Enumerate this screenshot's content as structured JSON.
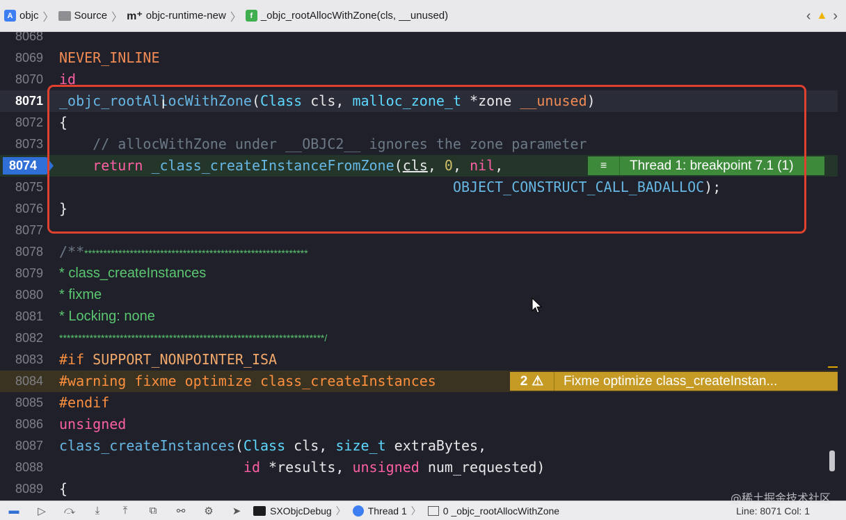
{
  "jumpbar": {
    "crumbs": [
      "objc",
      "Source",
      "objc-runtime-new",
      "_objc_rootAllocWithZone(cls, __unused)"
    ],
    "nav_back": "‹",
    "nav_forward": "›",
    "warn_icon": "warning-icon"
  },
  "editor": {
    "lines": [
      {
        "n": "8068"
      },
      {
        "n": "8069"
      },
      {
        "n": "8070"
      },
      {
        "n": "8071"
      },
      {
        "n": "8072"
      },
      {
        "n": "8073"
      },
      {
        "n": "8074"
      },
      {
        "n": "8075"
      },
      {
        "n": "8076"
      },
      {
        "n": "8077"
      },
      {
        "n": "8078"
      },
      {
        "n": "8079"
      },
      {
        "n": "8080"
      },
      {
        "n": "8081"
      },
      {
        "n": "8082"
      },
      {
        "n": "8083"
      },
      {
        "n": "8084"
      },
      {
        "n": "8085"
      },
      {
        "n": "8086"
      },
      {
        "n": "8087"
      },
      {
        "n": "8088"
      },
      {
        "n": "8089"
      }
    ],
    "code": {
      "l8069": "NEVER_INLINE",
      "l8070": "id",
      "l8071_func": "_objc_rootAllocWithZone",
      "l8071_open": "(",
      "l8071_type1": "Class",
      "l8071_arg1": " cls, ",
      "l8071_type2": "malloc_zone_t",
      "l8071_arg2": " *zone ",
      "l8071_unused": "__unused",
      "l8071_close": ")",
      "l8072": "{",
      "l8073": "    // allocWithZone under __OBJC2__ ignores the zone parameter",
      "l8074_ret": "    return ",
      "l8074_func": "_class_createInstanceFromZone",
      "l8074_open": "(",
      "l8074_cls": "cls",
      "l8074_comma1": ", ",
      "l8074_zero": "0",
      "l8074_comma2": ", ",
      "l8074_nil": "nil",
      "l8074_comma3": ",",
      "l8075_indent": "                                               ",
      "l8075_const": "OBJECT_CONSTRUCT_CALL_BADALLOC",
      "l8075_end": ");",
      "l8076": "}",
      "l8078_a": "/**",
      "l8078_b": "***********************************************************",
      "l8079": "* class_createInstances",
      "l8080": "* fixme",
      "l8081": "* Locking: none",
      "l8082": "**********************************************************************/",
      "l8083_a": "#if ",
      "l8083_b": "SUPPORT_NONPOINTER_ISA",
      "l8084": "#warning fixme optimize class_createInstances",
      "l8085": "#endif",
      "l8086": "unsigned",
      "l8087_func": "class_createInstances",
      "l8087_open": "(",
      "l8087_type1": "Class",
      "l8087_arg1": " cls, ",
      "l8087_type2": "size_t",
      "l8087_arg2": " extraBytes,",
      "l8088_indent": "                      ",
      "l8088_id": "id",
      "l8088_arg": " *results, ",
      "l8088_type": "unsigned",
      "l8088_arg2": " num_requested)",
      "l8089": "{"
    },
    "breakpoint": {
      "line_label": "8074",
      "banner_text": "Thread 1: breakpoint 7.1 (1)"
    },
    "warning": {
      "count": "2",
      "banner_text": "Fixme optimize class_createInstan..."
    }
  },
  "debugbar": {
    "scheme": "SXObjcDebug",
    "thread": "Thread 1",
    "frame": "0 _objc_rootAllocWithZone",
    "line_col": "Line: 8071  Col: 1"
  },
  "watermark": "@稀土掘金技术社区"
}
